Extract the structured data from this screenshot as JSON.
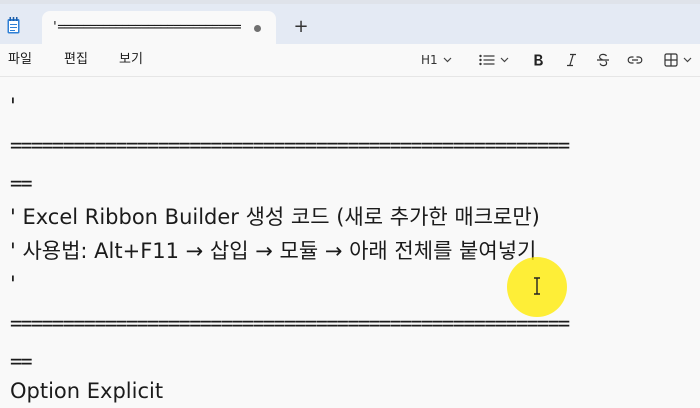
{
  "tab": {
    "title": "'=================================",
    "unsaved_indicator": "unsaved-dot-icon"
  },
  "new_tab_label": "+",
  "menu": {
    "file": "파일",
    "edit": "편집",
    "view": "보기"
  },
  "toolbar": {
    "heading": "H1",
    "list_icon": "list-icon",
    "bold_icon": "bold-icon",
    "italic_icon": "italic-icon",
    "strike_icon": "strikethrough-icon",
    "link_icon": "link-icon",
    "table_icon": "table-icon"
  },
  "editor": {
    "lines": [
      "'",
      "=====================================================",
      "==",
      "' Excel Ribbon Builder 생성 코드 (새로 추가한 매크로만)",
      "' 사용법: Alt+F11 → 삽입 → 모듈 → 아래 전체를 붙여넣기",
      "'",
      "=====================================================",
      "==",
      "Option Explicit"
    ]
  },
  "colors": {
    "titlebar": "#e4eaf4",
    "editor_bg": "#f9f9f9",
    "text": "#1b1b1b",
    "cursor_highlight": "#ffeb00"
  }
}
